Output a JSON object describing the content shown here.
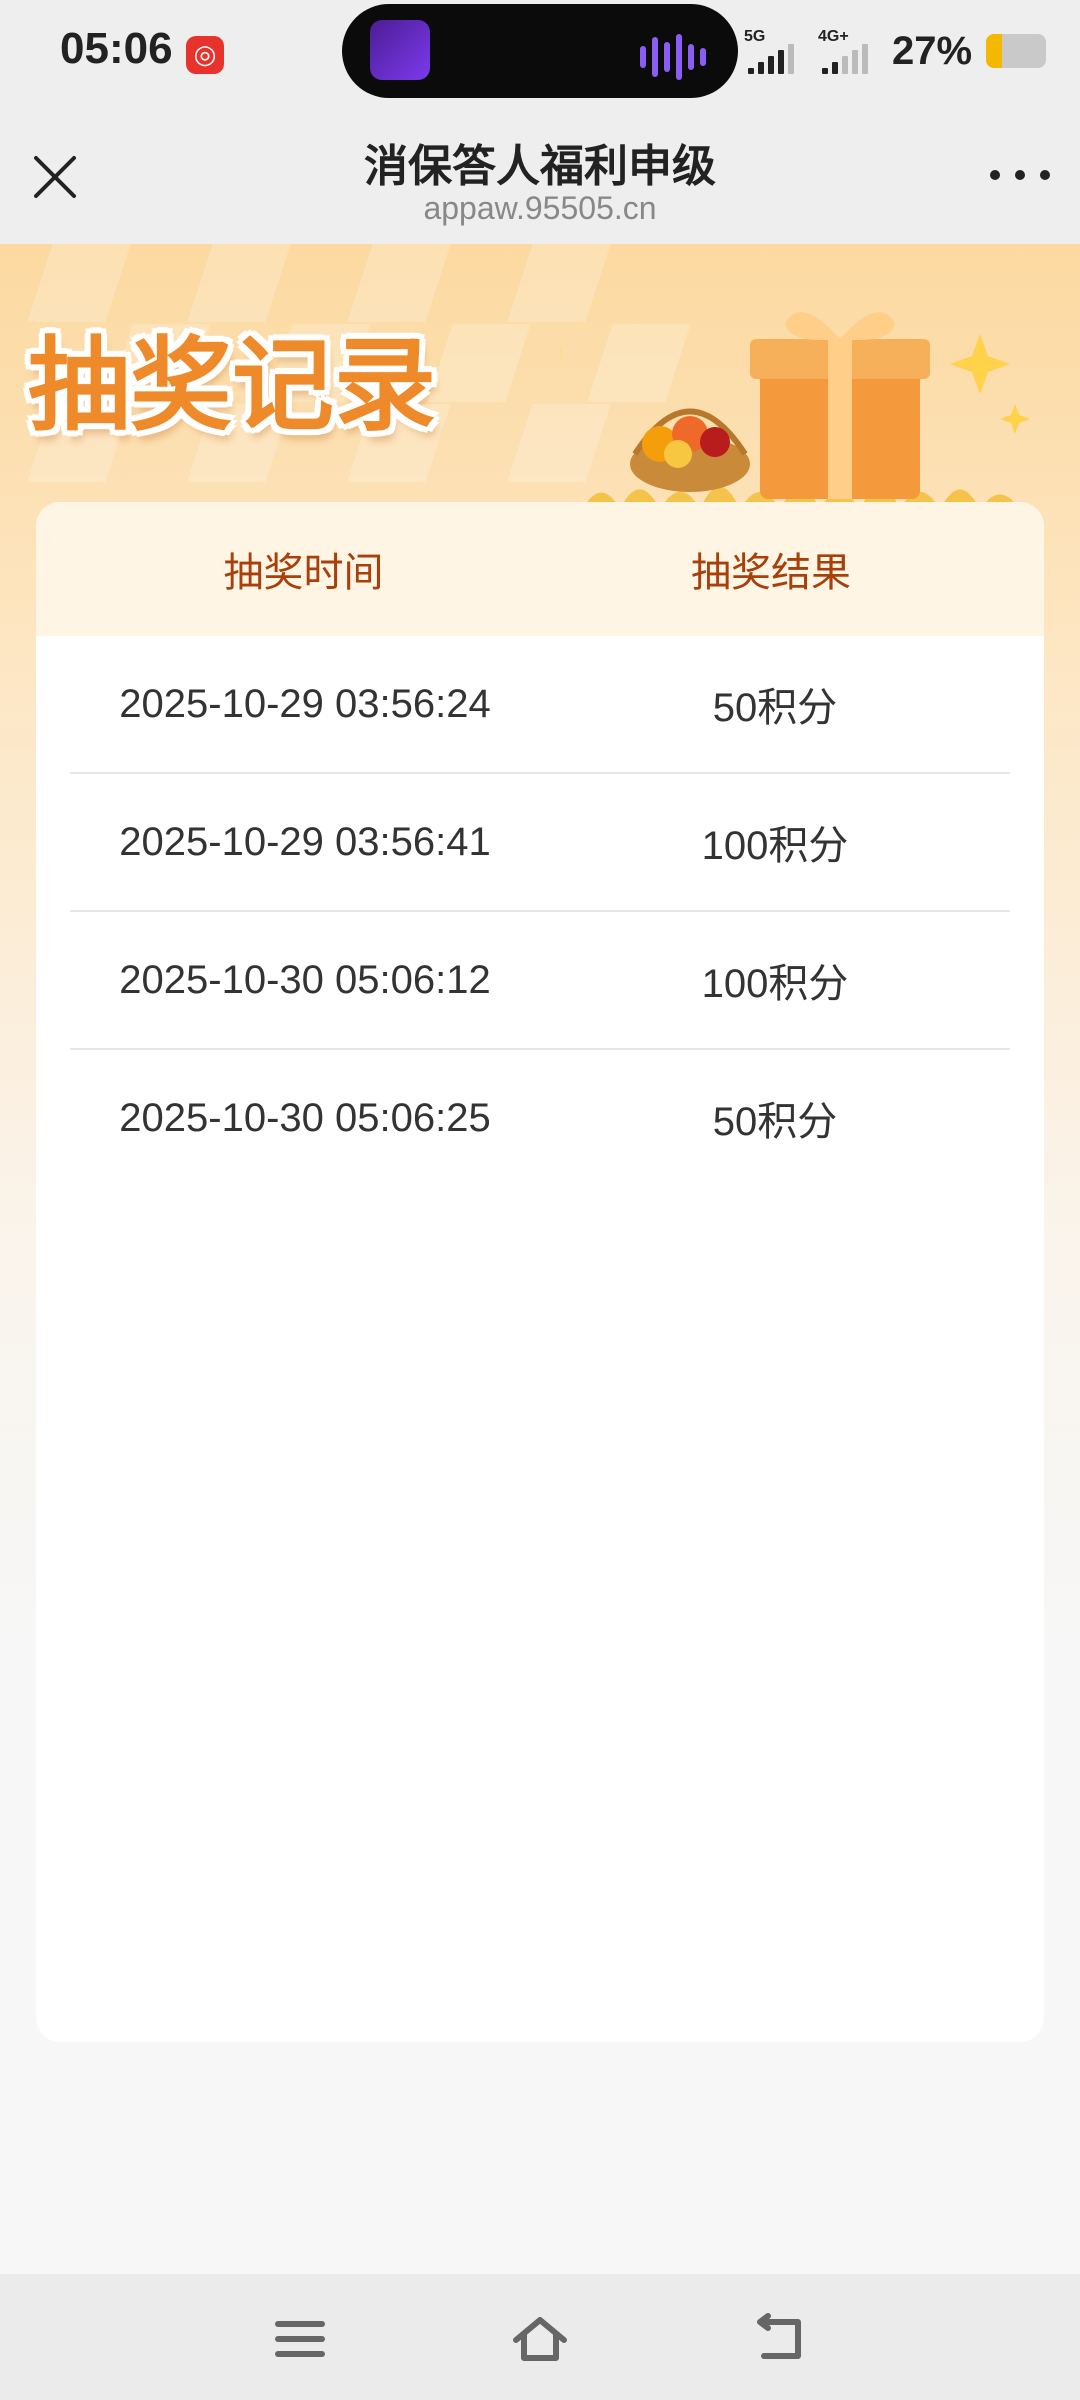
{
  "status_bar": {
    "time": "05:06",
    "network_1": "5G",
    "network_2": "4G+",
    "battery_percent": "27%",
    "battery_level": 0.27,
    "notification_icon": "netease-music-icon"
  },
  "nav": {
    "title": "消保答人福利申级",
    "url": "appaw.95505.cn"
  },
  "banner": {
    "heading": "抽奖记录"
  },
  "table": {
    "col_time": "抽奖时间",
    "col_result": "抽奖结果",
    "rows": [
      {
        "time": "2025-10-29 03:56:24",
        "result": "50积分"
      },
      {
        "time": "2025-10-29 03:56:41",
        "result": "100积分"
      },
      {
        "time": "2025-10-30 05:06:12",
        "result": "100积分"
      },
      {
        "time": "2025-10-30 05:06:25",
        "result": "50积分"
      }
    ]
  },
  "bottom_nav": {
    "icons": [
      "menu-icon",
      "home-icon",
      "back-icon"
    ]
  },
  "colors": {
    "accent_orange": "#ee8a2a",
    "header_text": "#a8400c",
    "header_bg": "#fff5e4"
  }
}
